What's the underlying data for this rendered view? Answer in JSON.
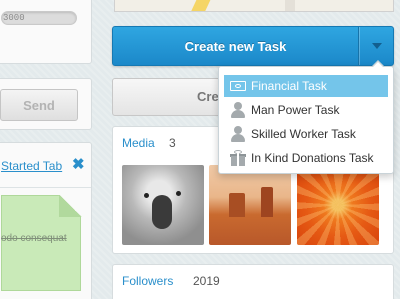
{
  "left": {
    "progress_text": "3000",
    "send_label": "Send",
    "tab_link": "Started Tab",
    "sticky_text": "odo consequat"
  },
  "actions": {
    "create_task_label": "Create new Task",
    "second_button_label": "Cre"
  },
  "task_menu": {
    "items": [
      {
        "label": "Financial Task",
        "icon": "money-icon",
        "active": true
      },
      {
        "label": "Man Power Task",
        "icon": "person-icon",
        "active": false
      },
      {
        "label": "Skilled Worker Task",
        "icon": "person-icon",
        "active": false
      },
      {
        "label": "In Kind Donations Task",
        "icon": "gift-icon",
        "active": false
      }
    ]
  },
  "media": {
    "title": "Media",
    "count": "3",
    "thumbnails": [
      "koala",
      "desert",
      "flower"
    ]
  },
  "followers": {
    "title": "Followers",
    "count": "2019"
  },
  "colors": {
    "accent_blue": "#2a8fcb",
    "primary_button": "#1b88c9",
    "menu_active": "#74c5ea",
    "sticky_note": "#c9eab8"
  }
}
